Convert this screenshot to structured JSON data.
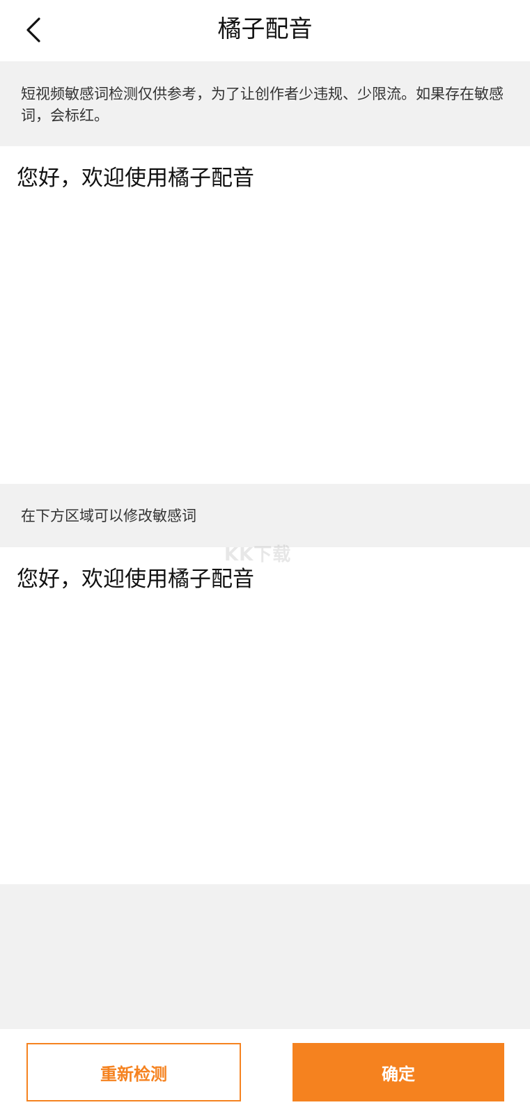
{
  "header": {
    "title": "橘子配音",
    "back_icon": "chevron-left-icon"
  },
  "notice": {
    "text": "短视频敏感词检测仅供参考，为了让创作者少违规、少限流。如果存在敏感词，会标红。"
  },
  "original_text": {
    "content": "您好，欢迎使用橘子配音"
  },
  "edit_section": {
    "label": "在下方区域可以修改敏感词",
    "content": "您好，欢迎使用橘子配音"
  },
  "watermark": {
    "text": "KK下载"
  },
  "footer": {
    "recheck_label": "重新检测",
    "confirm_label": "确定"
  },
  "colors": {
    "accent": "#f5821f",
    "section_bg": "#f1f1f1"
  }
}
